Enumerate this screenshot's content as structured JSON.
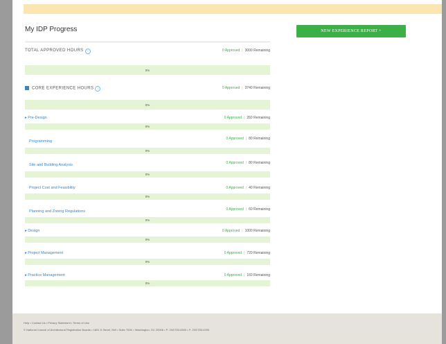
{
  "page": {
    "title": "My IDP Progress",
    "new_button": "NEW EXPERIENCE REPORT +",
    "approved_word": "Approved",
    "remaining_word": "Remaining"
  },
  "total": {
    "label": "TOTAL APPROVED HOURS",
    "approved": "0 Approved",
    "remaining": "3000 Remaining",
    "percent": "0%"
  },
  "core": {
    "label": "CORE EXPERIENCE HOURS",
    "approved": "0 Approved",
    "remaining": "3740 Remaining",
    "percent": "0%"
  },
  "rows": [
    {
      "label": "Pre-Design",
      "approved": "0 Approved",
      "remaining": "260 Remaining",
      "percent": "0%"
    },
    {
      "label": "Programming",
      "approved": "0 Approved",
      "remaining": "80 Remaining",
      "percent": "0%"
    },
    {
      "label": "Site and Building Analysis",
      "approved": "0 Approved",
      "remaining": "80 Remaining",
      "percent": "0%"
    },
    {
      "label": "Project Cost and Feasibility",
      "approved": "0 Approved",
      "remaining": "40 Remaining",
      "percent": "0%"
    },
    {
      "label": "Planning and Zoning Regulations",
      "approved": "0 Approved",
      "remaining": "60 Remaining",
      "percent": "0%"
    },
    {
      "label": "Design",
      "approved": "0 Approved",
      "remaining": "1000 Remaining",
      "percent": "0%"
    },
    {
      "label": "Project Management",
      "approved": "0 Approved",
      "remaining": "720 Remaining",
      "percent": "0%"
    },
    {
      "label": "Practice Management",
      "approved": "0 Approved",
      "remaining": "160 Remaining",
      "percent": "0%"
    }
  ],
  "footer": {
    "links": "Help  •  Contact Us  •  Privacy Statement  •  Terms of Use",
    "address": "© National Council of Architectural Registration Boards  •  1801 K Street, NW  •  Suite 700K  •  Washington, DC 20006  •  P: 202/783-6500  •  F: 202/783-0290"
  }
}
